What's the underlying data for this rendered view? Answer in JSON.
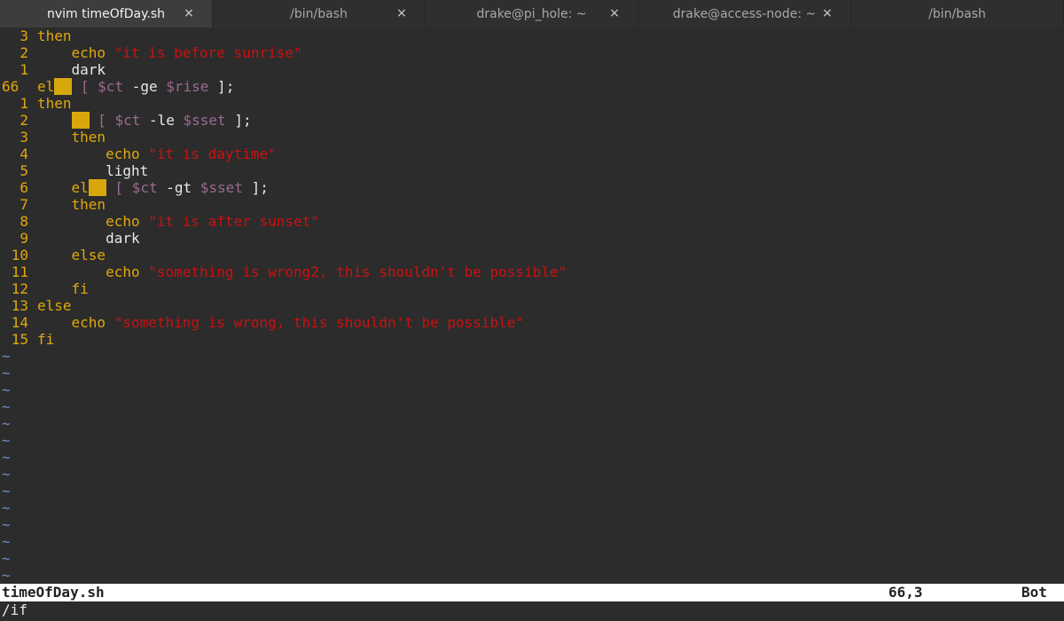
{
  "tabs": [
    {
      "label": "nvim timeOfDay.sh",
      "active": true,
      "close": "×"
    },
    {
      "label": "/bin/bash",
      "active": false,
      "close": "×"
    },
    {
      "label": "drake@pi_hole: ~",
      "active": false,
      "close": "×"
    },
    {
      "label": "drake@access-node: ~",
      "active": false,
      "close": "×"
    },
    {
      "label": "/bin/bash",
      "active": false,
      "close": ""
    }
  ],
  "editor": {
    "lines": [
      {
        "num": "3",
        "segments": [
          {
            "t": "then",
            "c": "kw"
          }
        ]
      },
      {
        "num": "2",
        "segments": [
          {
            "t": "    "
          },
          {
            "t": "echo ",
            "c": "cmd"
          },
          {
            "t": "\"it is before sunrise\"",
            "c": "str"
          }
        ]
      },
      {
        "num": "1",
        "segments": [
          {
            "t": "    "
          },
          {
            "t": "dark",
            "c": "plain"
          }
        ]
      },
      {
        "num": "66",
        "current": true,
        "segments": [
          {
            "t": "el",
            "c": "kw"
          },
          {
            "cursor": true
          },
          {
            "t": " [ ",
            "c": "br"
          },
          {
            "t": "$ct",
            "c": "var"
          },
          {
            "t": " -ge ",
            "c": "plain"
          },
          {
            "t": "$rise",
            "c": "var"
          },
          {
            "t": " ];",
            "c": "plain"
          }
        ]
      },
      {
        "num": "1",
        "segments": [
          {
            "t": "then",
            "c": "kw"
          }
        ]
      },
      {
        "num": "2",
        "segments": [
          {
            "t": "    "
          },
          {
            "cursor": true
          },
          {
            "t": " [ ",
            "c": "br"
          },
          {
            "t": "$ct",
            "c": "var"
          },
          {
            "t": " -le ",
            "c": "plain"
          },
          {
            "t": "$sset",
            "c": "var"
          },
          {
            "t": " ];",
            "c": "plain"
          }
        ]
      },
      {
        "num": "3",
        "segments": [
          {
            "t": "    "
          },
          {
            "t": "then",
            "c": "kw"
          }
        ]
      },
      {
        "num": "4",
        "segments": [
          {
            "t": "        "
          },
          {
            "t": "echo ",
            "c": "cmd"
          },
          {
            "t": "\"it is daytime\"",
            "c": "str"
          }
        ]
      },
      {
        "num": "5",
        "segments": [
          {
            "t": "        "
          },
          {
            "t": "light",
            "c": "plain"
          }
        ]
      },
      {
        "num": "6",
        "segments": [
          {
            "t": "    "
          },
          {
            "t": "el",
            "c": "kw"
          },
          {
            "cursor": true
          },
          {
            "t": " [ ",
            "c": "br"
          },
          {
            "t": "$ct",
            "c": "var"
          },
          {
            "t": " -gt ",
            "c": "plain"
          },
          {
            "t": "$sset",
            "c": "var"
          },
          {
            "t": " ];",
            "c": "plain"
          }
        ]
      },
      {
        "num": "7",
        "segments": [
          {
            "t": "    "
          },
          {
            "t": "then",
            "c": "kw"
          }
        ]
      },
      {
        "num": "8",
        "segments": [
          {
            "t": "        "
          },
          {
            "t": "echo ",
            "c": "cmd"
          },
          {
            "t": "\"it is after sunset\"",
            "c": "str"
          }
        ]
      },
      {
        "num": "9",
        "segments": [
          {
            "t": "        "
          },
          {
            "t": "dark",
            "c": "plain"
          }
        ]
      },
      {
        "num": "10",
        "segments": [
          {
            "t": "    "
          },
          {
            "t": "else",
            "c": "kw"
          }
        ]
      },
      {
        "num": "11",
        "segments": [
          {
            "t": "        "
          },
          {
            "t": "echo ",
            "c": "cmd"
          },
          {
            "t": "\"something is wrong2, this shouldn't be possible\"",
            "c": "str"
          }
        ]
      },
      {
        "num": "12",
        "segments": [
          {
            "t": "    "
          },
          {
            "t": "fi",
            "c": "kw"
          }
        ]
      },
      {
        "num": "13",
        "segments": [
          {
            "t": "else",
            "c": "kw"
          }
        ]
      },
      {
        "num": "14",
        "segments": [
          {
            "t": "    "
          },
          {
            "t": "echo ",
            "c": "cmd"
          },
          {
            "t": "\"something is wrong, this shouldn't be possible\"",
            "c": "str"
          }
        ]
      },
      {
        "num": "15",
        "segments": [
          {
            "t": "fi",
            "c": "kw"
          }
        ]
      }
    ],
    "tilde_char": "~",
    "tilde_count": 14
  },
  "statusline": {
    "filename": "timeOfDay.sh",
    "position": "66,3",
    "scroll": "Bot"
  },
  "cmdline": {
    "text": "/if"
  },
  "colors": {
    "keyword": "#e1a80c",
    "string": "#cc1010",
    "variable": "#9b6a8f",
    "tilde": "#6c8dc4",
    "background": "#2c2c2c"
  }
}
